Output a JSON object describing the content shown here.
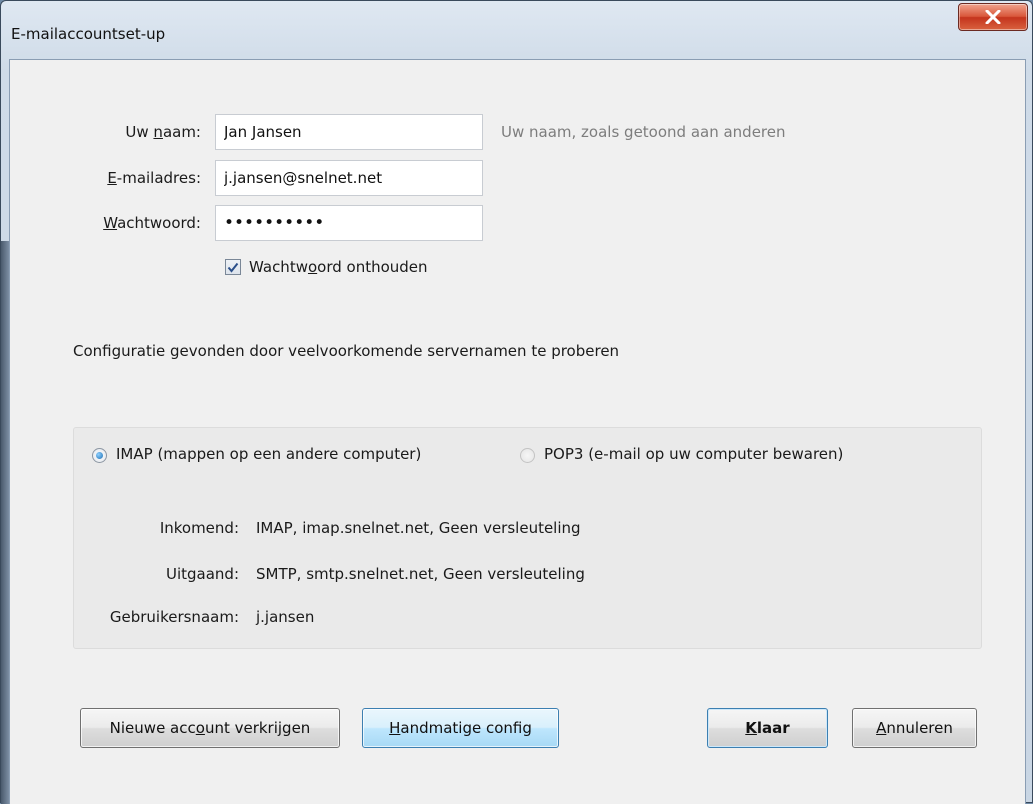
{
  "window": {
    "title": "E-mailaccountset-up"
  },
  "form": {
    "name": {
      "label_pre": "Uw ",
      "label_ul": "n",
      "label_post": "aam:",
      "value": "Jan Jansen",
      "hint": "Uw naam, zoals getoond aan anderen"
    },
    "email": {
      "label_pre": "",
      "label_ul": "E",
      "label_post": "-mailadres:",
      "value": "j.jansen@snelnet.net"
    },
    "password": {
      "label_pre": "",
      "label_ul": "W",
      "label_post": "achtwoord:",
      "value": "jjpassword"
    },
    "remember": {
      "label_pre": "Wachtw",
      "label_ul": "o",
      "label_post": "ord onthouden",
      "checked": true
    }
  },
  "status_message": "Configuratie gevonden door veelvoorkomende servernamen te proberen",
  "config": {
    "imap_option": {
      "label": "IMAP (mappen op een andere computer)",
      "selected": true
    },
    "pop3_option": {
      "label": "POP3 (e-mail op uw computer bewaren)",
      "selected": false
    },
    "incoming": {
      "label": "Inkomend:",
      "value": "IMAP, imap.snelnet.net, Geen versleuteling"
    },
    "outgoing": {
      "label": "Uitgaand:",
      "value": "SMTP, smtp.snelnet.net, Geen versleuteling"
    },
    "username": {
      "label": "Gebruikersnaam:",
      "value": "j.jansen"
    }
  },
  "buttons": {
    "new_account": {
      "pre": "Nieuwe acc",
      "ul": "o",
      "post": "unt verkrijgen"
    },
    "manual_config": {
      "pre": "",
      "ul": "H",
      "post": "andmatige config"
    },
    "done": {
      "pre": "",
      "ul": "K",
      "post": "laar"
    },
    "cancel": {
      "pre": "",
      "ul": "A",
      "post": "nnuleren"
    }
  },
  "colors": {
    "close_button": "#c4341d",
    "hint_text": "#7d7d7d",
    "hot_button": "#bee6fd"
  }
}
